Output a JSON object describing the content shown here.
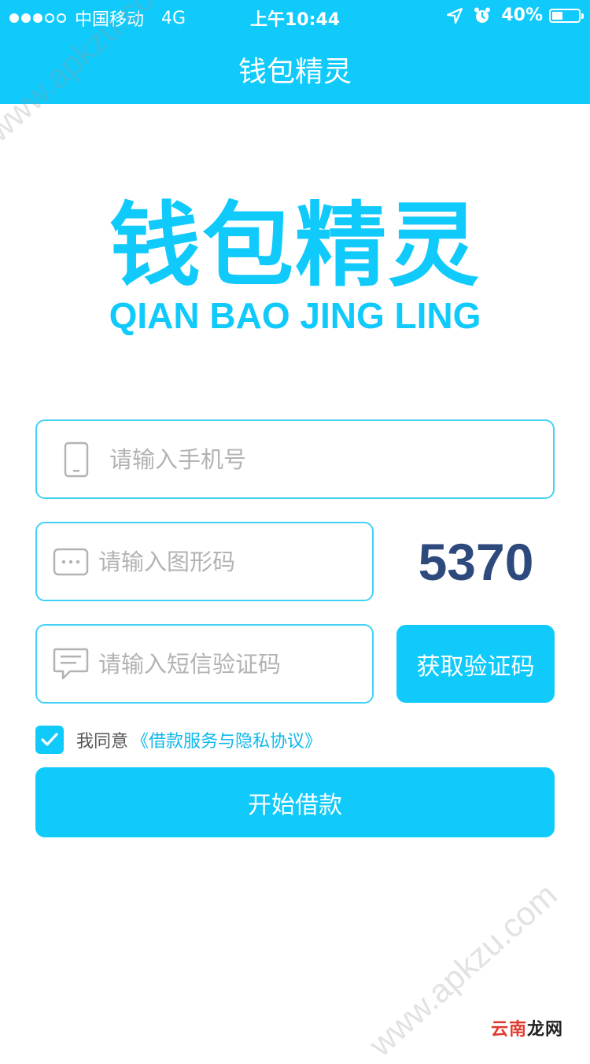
{
  "status_bar": {
    "signal_dots_full": 3,
    "signal_dots_total": 5,
    "carrier": "中国移动",
    "network": "4G",
    "time": "上午10:44",
    "battery_percent": "40%",
    "battery_level": 0.4,
    "icons": [
      "location-arrow-icon",
      "alarm-clock-icon",
      "battery-icon"
    ]
  },
  "nav": {
    "title": "钱包精灵"
  },
  "logo": {
    "chinese": "钱包精灵",
    "pinyin": "QIAN BAO JING LING"
  },
  "form": {
    "phone": {
      "placeholder": "请输入手机号",
      "value": "",
      "icon": "mobile-phone-icon"
    },
    "captcha": {
      "placeholder": "请输入图形码",
      "value": "",
      "icon": "keyboard-dots-icon",
      "code": "5370"
    },
    "sms": {
      "placeholder": "请输入短信验证码",
      "value": "",
      "icon": "chat-bubble-icon",
      "button_label": "获取验证码"
    },
    "agreement": {
      "checked": true,
      "text": "我同意",
      "link_text": "《借款服务与隐私协议》"
    },
    "submit_label": "开始借款"
  },
  "watermarks": {
    "top": "www.apkzu.com",
    "bottom": "www.apkzu.com",
    "corner_part1": "云南",
    "corner_part2": "龙网"
  },
  "colors": {
    "primary": "#0fcafb",
    "border": "#42d1f5",
    "captcha_text": "#2e4a7d",
    "placeholder": "#b3b3b3",
    "link": "#0fb8ec"
  }
}
